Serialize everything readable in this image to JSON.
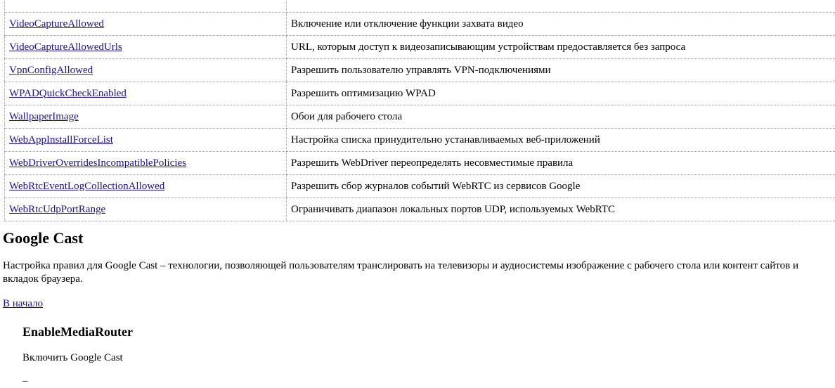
{
  "policies_table": {
    "rows": [
      {
        "name": "",
        "description": ""
      },
      {
        "name": "VideoCaptureAllowed",
        "description": "Включение или отключение функции захвата видео"
      },
      {
        "name": "VideoCaptureAllowedUrls",
        "description": "URL, которым доступ к видеозаписывающим устройствам предоставляется без запроса"
      },
      {
        "name": "VpnConfigAllowed",
        "description": "Разрешить пользователю управлять VPN-подключениями"
      },
      {
        "name": "WPADQuickCheckEnabled",
        "description": "Разрешить оптимизацию WPAD"
      },
      {
        "name": "WallpaperImage",
        "description": "Обои для рабочего стола"
      },
      {
        "name": "WebAppInstallForceList",
        "description": "Настройка списка принудительно устанавливаемых веб-приложений"
      },
      {
        "name": "WebDriverOverridesIncompatiblePolicies",
        "description": "Разрешить WebDriver переопределять несовместимые правила"
      },
      {
        "name": "WebRtcEventLogCollectionAllowed",
        "description": "Разрешить сбор журналов событий WebRTC из сервисов Google"
      },
      {
        "name": "WebRtcUdpPortRange",
        "description": "Ограничивать диапазон локальных портов UDP, используемых WebRTC"
      }
    ]
  },
  "section": {
    "title": "Google Cast",
    "description": "Настройка правил для Google Cast – технологии, позволяющей пользователям транслировать на телевизоры и аудиосистемы изображение с рабочего стола или контент сайтов и вкладок браузера.",
    "back_link": "В начало"
  },
  "policy": {
    "name": "EnableMediaRouter",
    "caption": "Включить Google Cast",
    "partial_text": "–"
  }
}
